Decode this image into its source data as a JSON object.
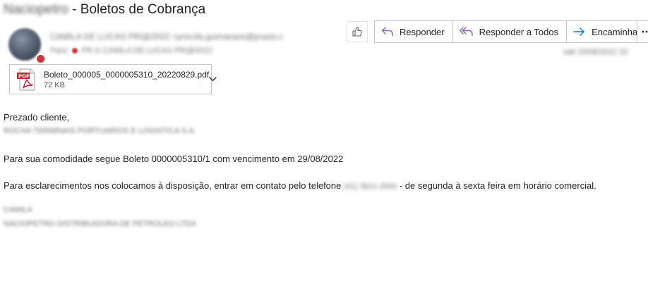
{
  "subject": {
    "sender_name": "Naciopetro",
    "title": " - Boletos de Cobrança"
  },
  "header": {
    "from": "CAMILA DE LUCAS PRI@2022 <priscila.guimaraes@praxis.c",
    "to_label": "Para:",
    "to_recipients": "PR G CAMILA DE LUCAS PRI@2022",
    "date": "sab 20/08/2022 22:"
  },
  "toolbar": {
    "like_icon": "thumbs-up-icon",
    "reply_label": "Responder",
    "reply_all_label": "Responder a Todos",
    "forward_label": "Encaminhar",
    "more_icon": "more-icon"
  },
  "attachment": {
    "filename": "Boleto_000005_0000005310_20220829.pdf",
    "size": "72 KB",
    "icon": "pdf-file-icon"
  },
  "body": {
    "greeting": "Prezado cliente,",
    "company": "ROCHA TERMINAIS PORTUARIOS E LOGISTICA S.A.",
    "line1": "Para sua comodidade segue Boleto 0000005310/1 com vencimento em 29/08/2022",
    "line2_part1": "Para esclarecimentos nos colocamos à disposição, entrar em contato pelo telefone",
    "phone": "(41) 3621-2500",
    "line2_part2": " - de segunda à sexta feira em horário comercial.",
    "signature_name": "CAMILA",
    "signature_company": "NACIOPETRO DISTRIBUIDORA DE PETROLEO LTDA"
  },
  "colors": {
    "accent": "#8764b8",
    "forward": "#0078d4",
    "pdf_red": "#c4262e",
    "presence": "#d13438"
  }
}
